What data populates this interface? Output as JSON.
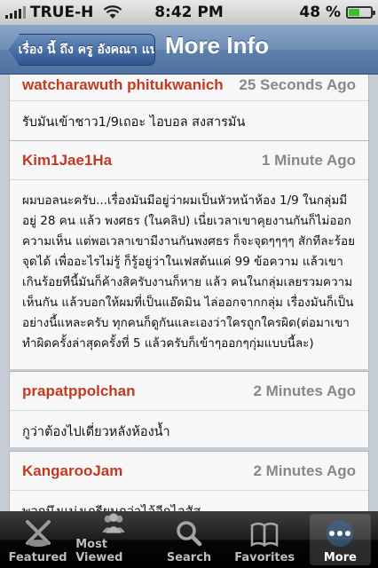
{
  "status_bar": {
    "carrier": "TRUE-H",
    "time": "8:42 PM",
    "battery": "48 %",
    "battery_level": 0.48
  },
  "nav": {
    "back_label": "เรื่อง นี้ ถึง ครู อังคณา แน่",
    "title": "More Info"
  },
  "comments": [
    {
      "author": "watcharawuth phitukwanich",
      "time": "25 Seconds Ago",
      "text": "รับมันเข้าชาว1/9เถอะ ไอบอล สงสารมัน"
    },
    {
      "author": "Kim1Jae1Ha",
      "time": "1 Minute Ago",
      "text": "ผมบอลนะครับ...เรื่องมันมีอยู่ว่าผมเป็นหัวหน้าห้อง 1/9 ในกลุ่มมีอยู่ 28 คน แล้ว พงศธร (ในคลิป) เนี่ยเวลาเขาคุยงานกันก็ไม่ออกความเห็น แต่พอเวลาเขามีงานกันพงศธร ก็จะจุดๆๆๆๆ สักทีละร้อยจุดได้ เพื่ออะไรไม่รู้ ก็รู้อยู่ว่าในเฟสต้นแค่ 99 ข้อความ แล้วเขาเกินร้อยทีนี้มันก็ค้างสิครับงานก็หาย แล้ว คนในกลุ่มเลยรวมความเห็นกัน แล้วบอกให้ผมที่เป็นแอ๊ดมิน ไล่ออกจากกลุ่ม  เรื่องมันก็เป็นอย่างนี้แหละครับ ทุกคนก็ดูกันและเองว่าใครถูกใครผิด(ต่อมาเขาทำผิดครั้งล่าสุดครั้งที่ 5 แล้วครับก็เข้าๆออกๆกุ่มแบบนี้ละ)"
    },
    {
      "author": "prapatppolchan",
      "time": "2 Minutes Ago",
      "text": "กูว่าต้องไปเดี่ยวหลังห้องน้ำ"
    },
    {
      "author": "KangarooJam",
      "time": "2 Minutes Ago",
      "text": "พวกมึงแม่งเกรียนกว่าไอ้อีกไอสัส"
    }
  ],
  "tabs": [
    {
      "label": "Featured",
      "icon": "featured-icon"
    },
    {
      "label": "Most Viewed",
      "icon": "users-icon"
    },
    {
      "label": "Search",
      "icon": "search-icon"
    },
    {
      "label": "Favorites",
      "icon": "book-icon"
    },
    {
      "label": "More",
      "icon": "more-icon"
    }
  ],
  "colors": {
    "author": "#c23a22",
    "nav": "#5e80ab",
    "background": "#c5ccd4"
  }
}
